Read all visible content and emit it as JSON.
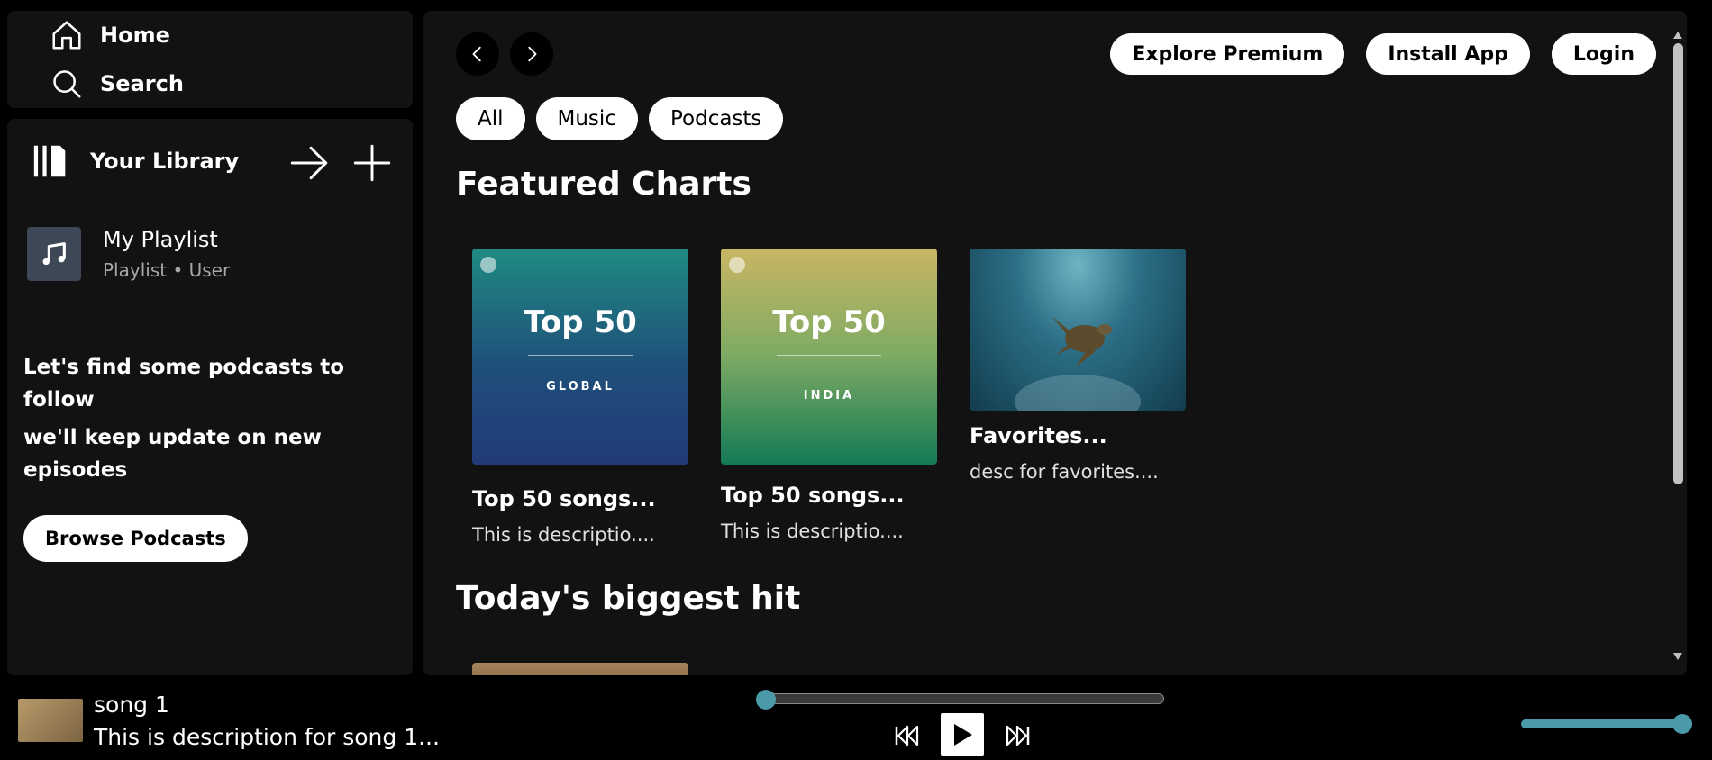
{
  "sidebar": {
    "nav": {
      "home_label": "Home",
      "search_label": "Search"
    },
    "library": {
      "title": "Your Library",
      "playlists": [
        {
          "title": "My Playlist",
          "subtitle": "Playlist • User"
        }
      ],
      "podcast_prompt": {
        "line1": "Let's find some podcasts to follow",
        "line2": "we'll keep update on new episodes",
        "button_label": "Browse Podcasts"
      }
    }
  },
  "header": {
    "buttons": {
      "explore_premium": "Explore Premium",
      "install_app": "Install App",
      "login": "Login"
    },
    "filters": [
      "All",
      "Music",
      "Podcasts"
    ]
  },
  "main": {
    "featured": {
      "title": "Featured Charts",
      "cards": [
        {
          "cover_title": "Top 50",
          "cover_region": "GLOBAL",
          "title": "Top 50 songs...",
          "desc": "This is descriptio...."
        },
        {
          "cover_title": "Top 50",
          "cover_region": "INDIA",
          "title": "Top 50 songs...",
          "desc": "This is descriptio...."
        },
        {
          "title": "Favorites...",
          "desc": "desc for favorites...."
        }
      ]
    },
    "hits": {
      "title": "Today's biggest hit"
    }
  },
  "player": {
    "song_title": "song 1",
    "song_desc": "This is description for song 1...",
    "progress_fraction": 0.0,
    "volume_fraction": 1.0
  },
  "colors": {
    "accent": "#4a9aaa",
    "panel": "#121212",
    "background": "#000000"
  }
}
